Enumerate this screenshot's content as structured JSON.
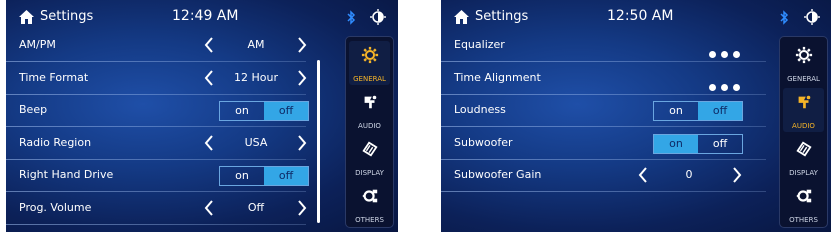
{
  "colors": {
    "accent": "#f5b428",
    "toggle_active": "#33a6e6",
    "bluetooth": "#2f8cff"
  },
  "screen1": {
    "title": "Settings",
    "time": "12:49 AM",
    "rows": [
      {
        "label": "AM/PM",
        "type": "select",
        "value": "AM"
      },
      {
        "label": "Time Format",
        "type": "select",
        "value": "12 Hour"
      },
      {
        "label": "Beep",
        "type": "toggle",
        "on": "on",
        "off": "off",
        "selected": "off"
      },
      {
        "label": "Radio Region",
        "type": "select",
        "value": "USA"
      },
      {
        "label": "Right Hand Drive",
        "type": "toggle",
        "on": "on",
        "off": "off",
        "selected": "off"
      },
      {
        "label": "Prog. Volume",
        "type": "select",
        "value": "Off"
      }
    ],
    "tabs": [
      {
        "label": "GENERAL",
        "icon": "gear-icon",
        "active": true
      },
      {
        "label": "AUDIO",
        "icon": "audio-icon",
        "active": false
      },
      {
        "label": "DISPLAY",
        "icon": "display-icon",
        "active": false
      },
      {
        "label": "OTHERS",
        "icon": "others-icon",
        "active": false
      }
    ]
  },
  "screen2": {
    "title": "Settings",
    "time": "12:50 AM",
    "rows": [
      {
        "label": "Equalizer",
        "type": "more"
      },
      {
        "label": "Time Alignment",
        "type": "more"
      },
      {
        "label": "Loudness",
        "type": "toggle",
        "on": "on",
        "off": "off",
        "selected": "off"
      },
      {
        "label": "Subwoofer",
        "type": "toggle",
        "on": "on",
        "off": "off",
        "selected": "on"
      },
      {
        "label": "Subwoofer Gain",
        "type": "select",
        "value": "0"
      }
    ],
    "tabs": [
      {
        "label": "GENERAL",
        "icon": "gear-icon",
        "active": false
      },
      {
        "label": "AUDIO",
        "icon": "audio-icon",
        "active": true
      },
      {
        "label": "DISPLAY",
        "icon": "display-icon",
        "active": false
      },
      {
        "label": "OTHERS",
        "icon": "others-icon",
        "active": false
      }
    ]
  }
}
